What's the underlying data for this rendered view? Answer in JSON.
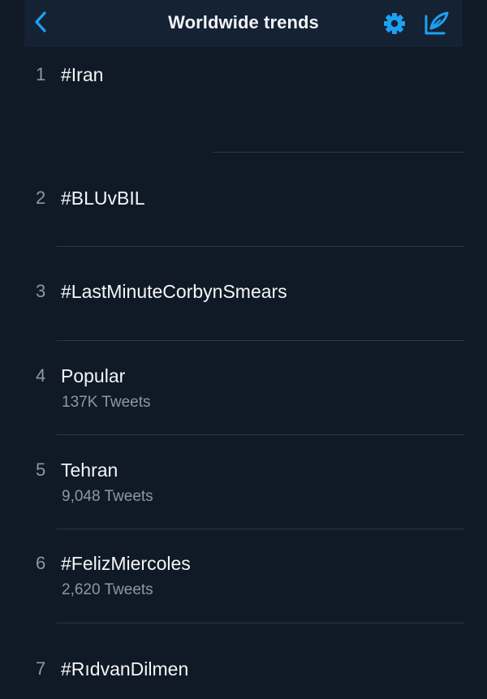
{
  "header": {
    "title": "Worldwide trends",
    "back_icon": "chevron-left-icon",
    "settings_icon": "gear-icon",
    "compose_icon": "compose-icon",
    "accent_color": "#1da1f2"
  },
  "trends": [
    {
      "rank": "1",
      "name": "#Iran",
      "tweets": ""
    },
    {
      "rank": "2",
      "name": "#BLUvBIL",
      "tweets": ""
    },
    {
      "rank": "3",
      "name": "#LastMinuteCorbynSmears",
      "tweets": ""
    },
    {
      "rank": "4",
      "name": "Popular",
      "tweets": "137K Tweets"
    },
    {
      "rank": "5",
      "name": "Tehran",
      "tweets": "9,048 Tweets"
    },
    {
      "rank": "6",
      "name": "#FelizMiercoles",
      "tweets": "2,620 Tweets"
    },
    {
      "rank": "7",
      "name": "#RıdvanDilmen",
      "tweets": ""
    }
  ]
}
